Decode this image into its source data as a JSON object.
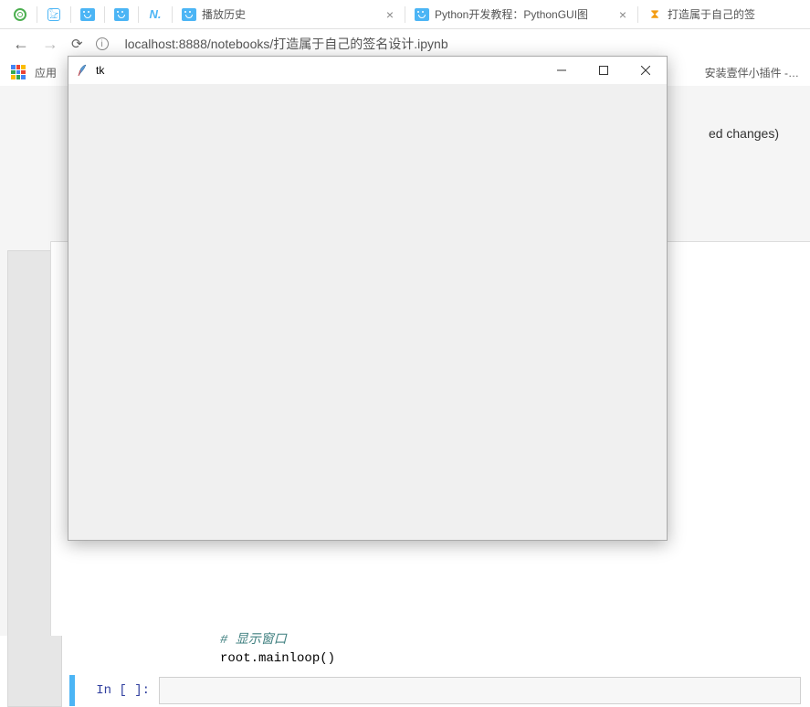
{
  "browser": {
    "tabs_playback": "播放历史",
    "tabs_python_tut": "Python开发教程：PythonGUI图",
    "tabs_signature": "打造属于自己的签",
    "url": "localhost:8888/notebooks/打造属于自己的签名设计.ipynb"
  },
  "bookmarks": {
    "apps": "应用",
    "plugin": "安装壹伴小插件 -…"
  },
  "notebook": {
    "unsaved": "ed changes)",
    "code_comment": "# 显示窗口",
    "code_line": "root.mainloop()",
    "prompt": "In [ ]:"
  },
  "tk": {
    "title": "tk",
    "min": "—",
    "max": "☐",
    "close": "✕"
  }
}
